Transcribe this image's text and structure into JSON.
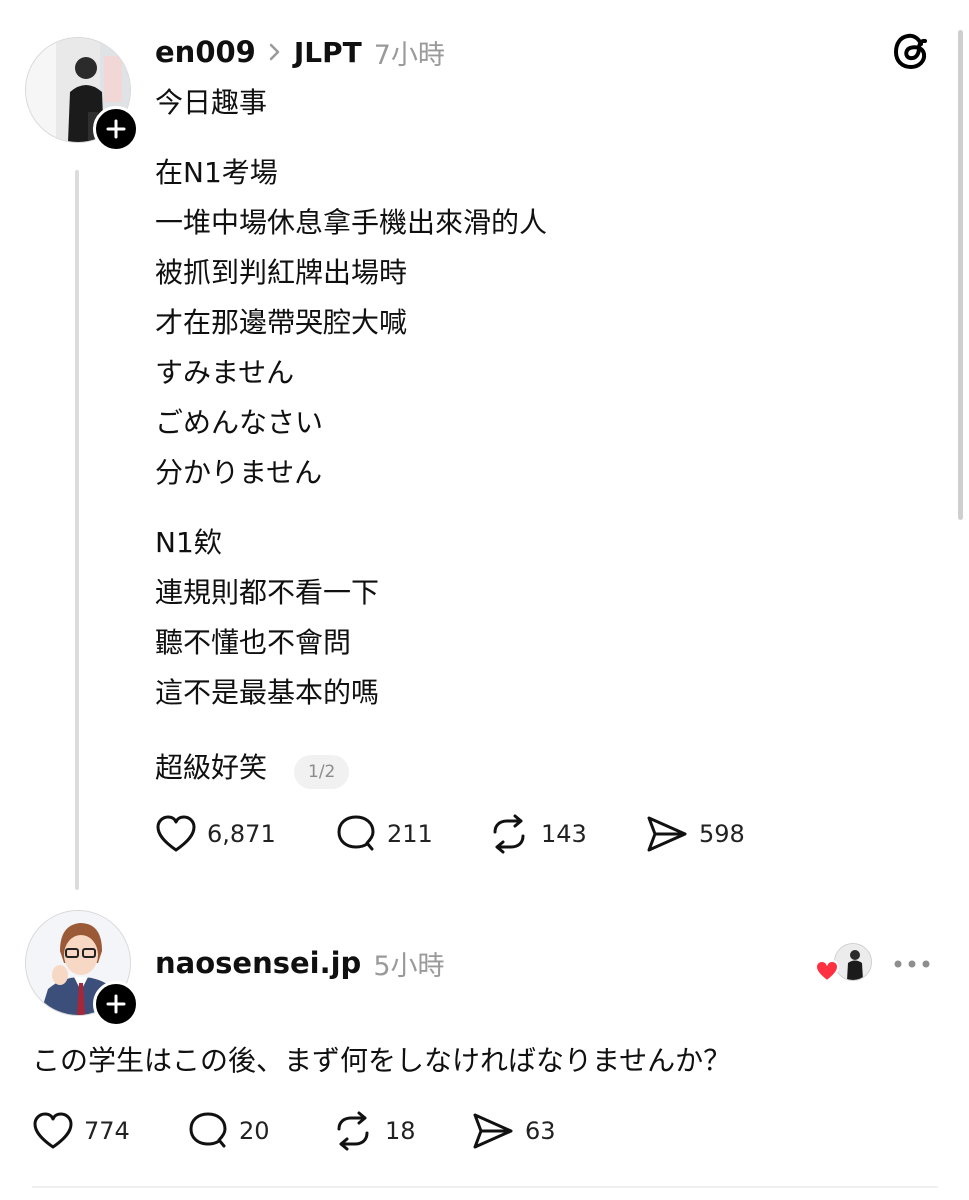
{
  "post": {
    "username": "en009",
    "separator_icon": "chevron-right-icon",
    "topic": "JLPT",
    "time": "7小時",
    "lines": [
      "今日趣事",
      "在N1考場",
      "一堆中場休息拿手機出來滑的人",
      "被抓到判紅牌出場時",
      "才在那邊帶哭腔大喊",
      "すみません",
      "ごめんなさい",
      "分かりません",
      "N1欸",
      "連規則都不看一下",
      "聽不懂也不會問",
      "這不是最基本的嗎",
      "超級好笑"
    ],
    "pager": "1/2",
    "likes": "6,871",
    "comments": "211",
    "reposts": "143",
    "shares": "598"
  },
  "reply": {
    "username": "naosensei.jp",
    "time": "5小時",
    "text": "この学生はこの後、まず何をしなければなりませんか？",
    "likes": "774",
    "comments": "20",
    "reposts": "18",
    "shares": "63"
  },
  "icons": {
    "app_logo": "threads-logo-icon",
    "follow": "plus-icon",
    "like": "heart-icon",
    "comment": "comment-icon",
    "repost": "repost-icon",
    "share": "send-icon",
    "more": "more-icon",
    "liked_by": "heart-icon"
  },
  "colors": {
    "text": "#101010",
    "muted": "#9a9a9a",
    "heart_red": "#ff3040",
    "divider": "#efefef"
  }
}
